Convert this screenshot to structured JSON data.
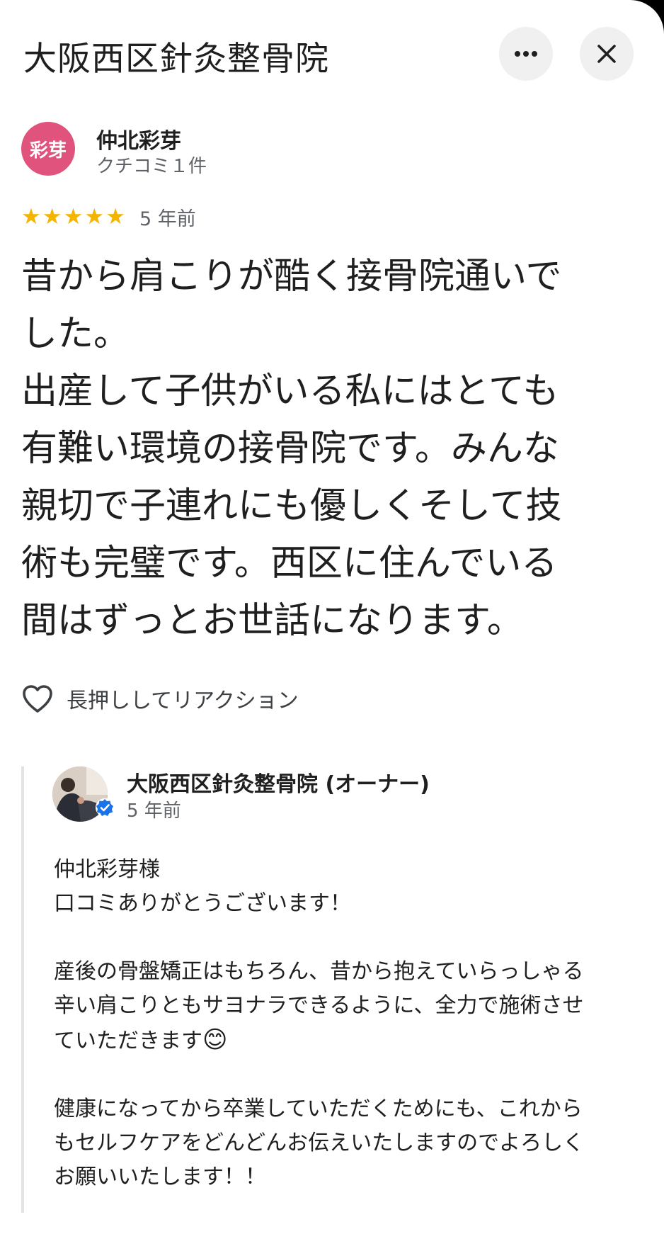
{
  "header": {
    "title": "大阪西区針灸整骨院",
    "more_icon": "more-horizontal-icon",
    "close_icon": "close-icon"
  },
  "review": {
    "avatar_text": "彩芽",
    "avatar_color": "#e0537c",
    "reviewer_name": "仲北彩芽",
    "review_count": "クチコミ１件",
    "rating": 5,
    "rating_max": 5,
    "time": "5 年前",
    "text": "昔から肩こりが酷く接骨院通いで\nした。\n出産して子供がいる私にはとても\n有難い環境の接骨院です。みんな\n親切で子連れにも優しくそして技\n術も完璧です。西区に住んでいる\n間はずっとお世話になります。"
  },
  "reaction": {
    "icon": "heart-outline-icon",
    "label": "長押ししてリアクション"
  },
  "owner_reply": {
    "name": "大阪西区針灸整骨院 (オーナー)",
    "time": "5 年前",
    "verified_icon": "verified-badge-icon",
    "text_main": "仲北彩芽様\n口コミありがとうございます！\n\n産後の骨盤矯正はもちろん、昔から抱えていらっしゃる\n辛い肩こりともサヨナラできるように、全力で施術させ\nていただきます",
    "emoji": "😊",
    "text_end": "\n\n健康になってから卒業していただくためにも、これから\nもセルフケアをどんどんお伝えいたしますのでよろしく\nお願いいたします！！"
  },
  "colors": {
    "star": "#f4b400",
    "verified": "#1a73e8",
    "secondary_text": "#5f6368"
  }
}
